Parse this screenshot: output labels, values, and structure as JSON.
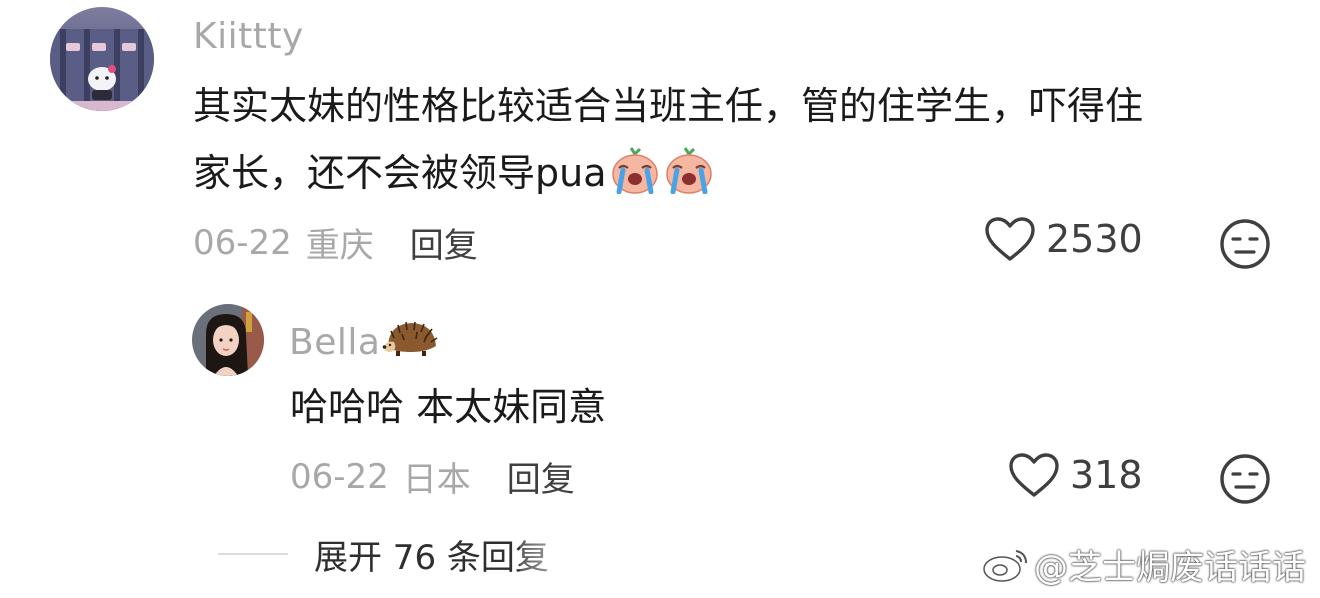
{
  "comment": {
    "username": "Kiittty",
    "text_line1": "其实太妹的性格比较适合当班主任，管的住学生，吓得住",
    "text_line2": "家长，还不会被领导pua",
    "emoji": [
      "crying-face-emoji",
      "crying-face-emoji"
    ],
    "date": "06-22",
    "location": "重庆",
    "reply_label": "回复",
    "like_count": "2530"
  },
  "reply": {
    "username": "Bella",
    "username_emoji": "hedgehog-emoji",
    "text": "哈哈哈 本太妹同意",
    "date": "06-22",
    "location": "日本",
    "reply_label": "回复",
    "like_count": "318"
  },
  "expand": {
    "label": "展开 76 条回复"
  },
  "watermark": {
    "text": "@芝士焗废话话话"
  },
  "colors": {
    "text_primary": "#1a1a1a",
    "text_secondary": "#a8a8a8",
    "action": "#3f3f3f"
  }
}
